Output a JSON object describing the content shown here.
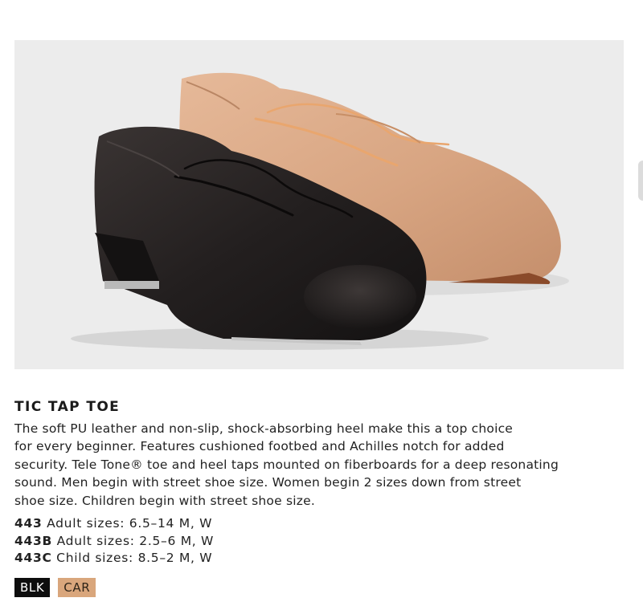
{
  "product": {
    "title": "TIC TAP TOE",
    "image_alt": "Black and caramel lace-up tap shoes",
    "description_lines": [
      "The soft PU leather and non-slip, shock-absorbing heel make this a top choice",
      "for every beginner. Features cushioned footbed and Achilles notch for added",
      "security. Tele Tone® toe and heel taps mounted on fiberboards for a deep resonating",
      "sound. Men begin with street shoe size. Women begin 2 sizes down from street",
      "shoe size. Children begin with street shoe size."
    ],
    "sizes": [
      {
        "code": "443",
        "text": "Adult sizes: 6.5–14 M, W"
      },
      {
        "code": "443B",
        "text": "Adult sizes: 2.5–6 M, W"
      },
      {
        "code": "443C",
        "text": "Child sizes: 8.5–2 M, W"
      }
    ],
    "colors": [
      {
        "label": "BLK",
        "color": "#0d0d0d"
      },
      {
        "label": "CAR",
        "color": "#d9a67c"
      }
    ]
  }
}
